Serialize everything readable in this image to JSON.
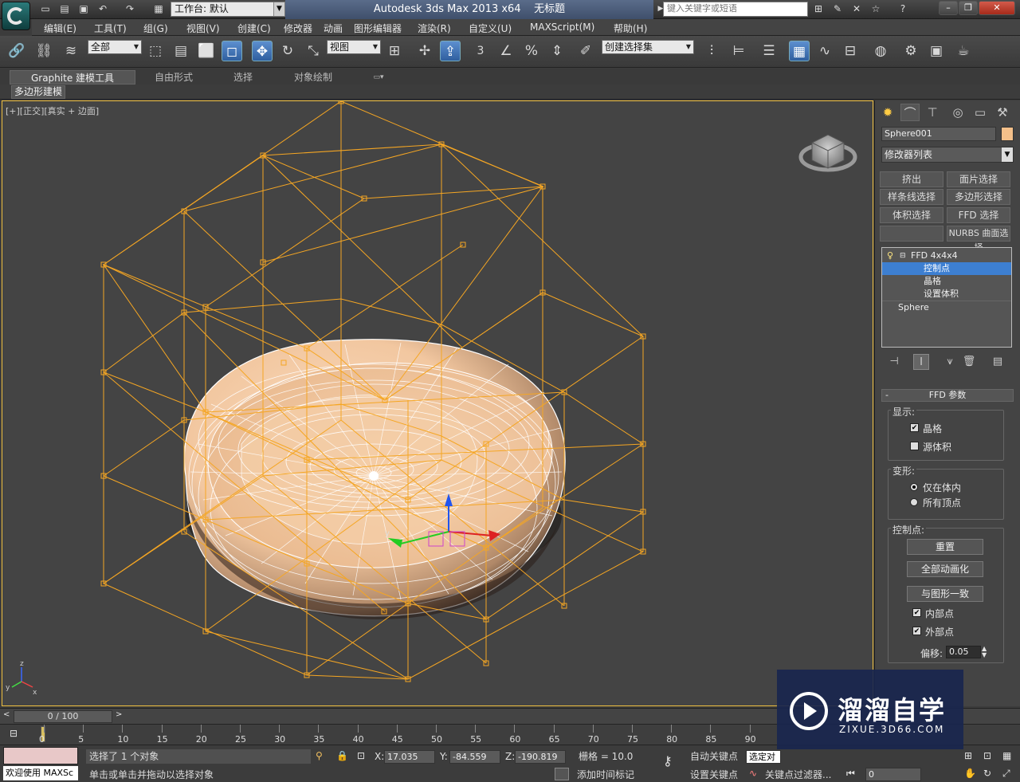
{
  "titlebar": {
    "workspace": "工作台: 默认",
    "app_title": "Autodesk 3ds Max  2013 x64",
    "doc_title": "无标题",
    "search_placeholder": "键入关键字或短语"
  },
  "menu": [
    "编辑(E)",
    "工具(T)",
    "组(G)",
    "视图(V)",
    "创建(C)",
    "修改器",
    "动画",
    "图形编辑器",
    "渲染(R)",
    "自定义(U)",
    "MAXScript(M)",
    "帮助(H)"
  ],
  "toolbar": {
    "selection_filter": "全部",
    "ref_coord": "视图",
    "named_selection": "创建选择集",
    "snap_angle_label": "3"
  },
  "ribbon": {
    "tabs": [
      "Graphite 建模工具",
      "自由形式",
      "选择",
      "对象绘制"
    ],
    "subtab": "多边形建模"
  },
  "viewport": {
    "label": "[+][正交][真实 + 边面]",
    "axis_x": "x",
    "axis_y": "y",
    "axis_z": "z"
  },
  "panel": {
    "object_name": "Sphere001",
    "object_color": "#f4c08a",
    "modifier_list": "修改器列表",
    "buttons": [
      "挤出",
      "面片选择",
      "样条线选择",
      "多边形选择",
      "体积选择",
      "FFD 选择",
      "",
      "NURBS 曲面选择"
    ],
    "stack": {
      "modifier": "FFD 4x4x4",
      "sub": [
        "控制点",
        "晶格",
        "设置体积"
      ],
      "base": "Sphere"
    },
    "rollout_title": "FFD 参数",
    "display_label": "显示:",
    "lattice_label": "晶格",
    "lattice_checked": true,
    "source_volume_label": "源体积",
    "source_volume_checked": false,
    "deform_label": "变形:",
    "only_in_volume": "仅在体内",
    "all_vertices": "所有顶点",
    "control_points_label": "控制点:",
    "reset": "重置",
    "animate_all": "全部动画化",
    "conform_to_shape": "与图形一致",
    "inside_points": "内部点",
    "inside_checked": true,
    "outside_points": "外部点",
    "outside_checked": true,
    "offset_label": "偏移:",
    "offset_value": "0.05"
  },
  "timeline": {
    "frame": "0 / 100",
    "ticks": [
      "0",
      "5",
      "10",
      "15",
      "20",
      "25",
      "30",
      "35",
      "40",
      "45",
      "50",
      "55",
      "60",
      "65",
      "70",
      "75",
      "80",
      "85",
      "90"
    ]
  },
  "status": {
    "welcome": "欢迎使用 MAXSc",
    "selected": "选择了 1 个对象",
    "prompt": "单击或单击并拖动以选择对象",
    "x_label": "X:",
    "x": "17.035",
    "y_label": "Y:",
    "y": "-84.559",
    "z_label": "Z:",
    "z": "-190.819",
    "grid": "栅格 = 10.0",
    "auto_key": "自动关键点",
    "set_key": "设置关键点",
    "selected_obj": "选定对",
    "key_filters": "关键点过滤器...",
    "add_time_tag": "添加时间标记",
    "frame_field": "0"
  },
  "watermark": {
    "title": "溜溜自学",
    "url": "ZIXUE.3D66.COM"
  }
}
